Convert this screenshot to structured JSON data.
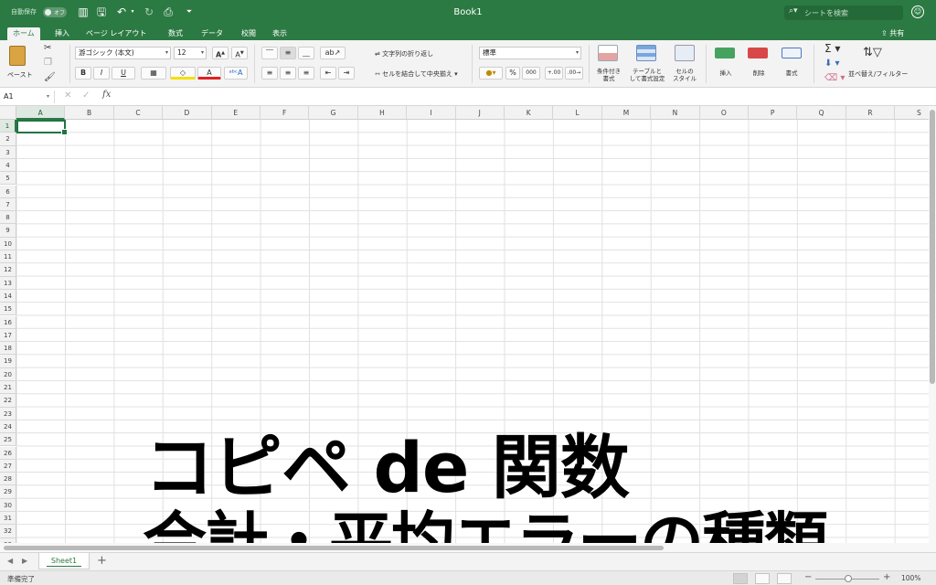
{
  "window": {
    "title": "Book1",
    "autosave_label": "自動保存",
    "autosave_state": "オフ",
    "search_placeholder": "シートを検索"
  },
  "tabs": [
    {
      "label": "ホーム",
      "active": true
    },
    {
      "label": "挿入"
    },
    {
      "label": "ページ レイアウト"
    },
    {
      "label": "数式"
    },
    {
      "label": "データ"
    },
    {
      "label": "校閲"
    },
    {
      "label": "表示"
    }
  ],
  "share_label": "共有",
  "ribbon": {
    "paste_label": "ペースト",
    "font_name": "游ゴシック (本文)",
    "font_size": "12",
    "bold": "B",
    "italic": "I",
    "underline": "U",
    "wrap_text": "文字列の折り返し",
    "merge_center": "セルを結合して中央揃え",
    "number_format": "標準",
    "percent": "%",
    "comma": "000",
    "dec_inc": ".00",
    "dec_dec": ".00",
    "conditional_format": [
      "条件付き",
      "書式"
    ],
    "format_table": [
      "テーブルと",
      "して書式設定"
    ],
    "cell_style": [
      "セルの",
      "スタイル"
    ],
    "insert": "挿入",
    "delete": "削除",
    "format": "書式",
    "sort_filter": "並べ替え/フィルター"
  },
  "formula_bar": {
    "name_box": "A1",
    "fx": "fx",
    "value": ""
  },
  "grid": {
    "columns": [
      "A",
      "B",
      "C",
      "D",
      "E",
      "F",
      "G",
      "H",
      "I",
      "J",
      "K",
      "L",
      "M",
      "N",
      "O",
      "P",
      "Q",
      "R",
      "S"
    ],
    "rows": [
      "1",
      "2",
      "3",
      "4",
      "5",
      "6",
      "7",
      "8",
      "9",
      "10",
      "11",
      "12",
      "13",
      "14",
      "15",
      "16",
      "17",
      "18",
      "19",
      "20",
      "21",
      "22",
      "23",
      "24",
      "25",
      "26",
      "27",
      "28",
      "29",
      "30",
      "31",
      "32",
      "33"
    ],
    "selected_cell": "A1"
  },
  "overlay": {
    "line1": "コピペ de 関数",
    "line2": "合計・平均エラーの種類"
  },
  "sheets": [
    {
      "label": "Sheet1",
      "active": true
    }
  ],
  "add_sheet": "+",
  "status": {
    "ready": "準備完了",
    "zoom": "100%"
  },
  "colors": {
    "accent": "#2c7a43",
    "active_cell_border": "#217346"
  }
}
